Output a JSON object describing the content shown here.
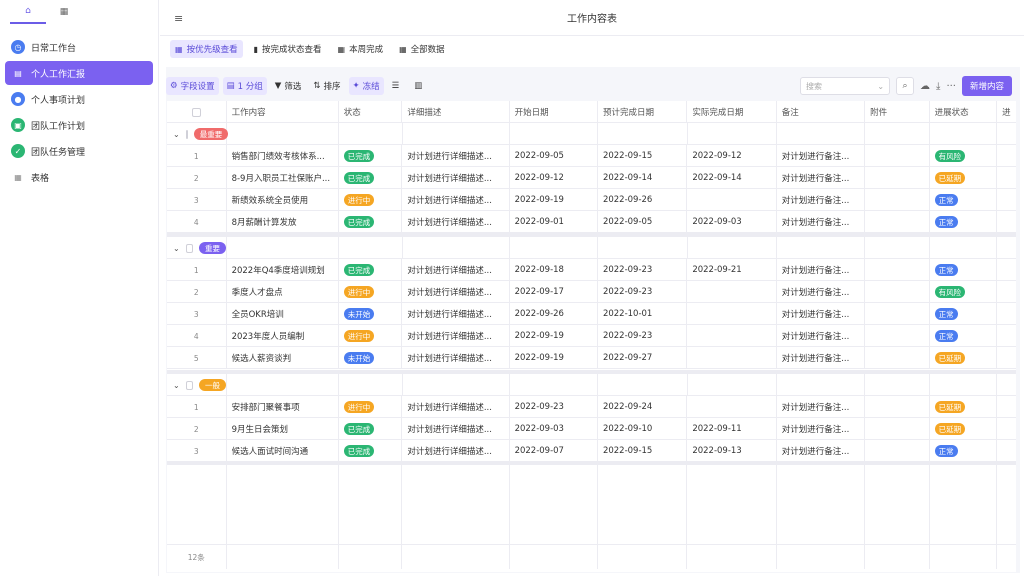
{
  "sidebar": {
    "tabs": [
      {
        "icon": "home-icon",
        "glyph": "⌂"
      },
      {
        "icon": "grid-icon",
        "glyph": "▦"
      }
    ],
    "items": [
      {
        "label": "日常工作台",
        "icon": "clock-icon",
        "glyph": "◷",
        "color": "#4a7cf0",
        "active": false
      },
      {
        "label": "个人工作汇报",
        "icon": "calendar-icon",
        "glyph": "▤",
        "color": "#ffffff",
        "active": true
      },
      {
        "label": "个人事项计划",
        "icon": "person-icon",
        "glyph": "●",
        "color": "#4a7cf0",
        "active": false
      },
      {
        "label": "团队工作计划",
        "icon": "clipboard-icon",
        "glyph": "▣",
        "color": "#2bb673",
        "active": false
      },
      {
        "label": "团队任务管理",
        "icon": "thumbs-up-icon",
        "glyph": "✓",
        "color": "#2bb673",
        "active": false
      },
      {
        "label": "表格",
        "icon": "table-icon",
        "glyph": "▦",
        "color": "#888888",
        "active": false
      }
    ]
  },
  "header": {
    "menu_icon": "≡",
    "title": "工作内容表"
  },
  "views": [
    {
      "label": "按优先级查看",
      "glyph": "▦",
      "active": true
    },
    {
      "label": "按完成状态查看",
      "glyph": "▮",
      "active": false
    },
    {
      "label": "本周完成",
      "glyph": "▦",
      "active": false
    },
    {
      "label": "全部数据",
      "glyph": "▦",
      "active": false
    }
  ],
  "toolbar": {
    "buttons": [
      {
        "label": "字段设置",
        "glyph": "⚙",
        "highlight": true
      },
      {
        "label": "1 分组",
        "glyph": "▤",
        "highlight": true
      },
      {
        "label": "筛选",
        "glyph": "▼",
        "highlight": false
      },
      {
        "label": "排序",
        "glyph": "⇅",
        "highlight": false
      },
      {
        "label": "冻结",
        "glyph": "✦",
        "highlight": true
      },
      {
        "label": "",
        "glyph": "☰",
        "highlight": false
      },
      {
        "label": "",
        "glyph": "▥",
        "highlight": false
      }
    ],
    "search_placeholder": "搜索",
    "search_chevron": "⌄",
    "search_icon": "⌕",
    "upload_icon": "☁",
    "download_icon": "⤓",
    "more_icon": "···",
    "add_label": "新增内容"
  },
  "table": {
    "columns": [
      "",
      "工作内容",
      "状态",
      "详细描述",
      "开始日期",
      "预计完成日期",
      "实际完成日期",
      "备注",
      "附件",
      "进展状态",
      "进"
    ],
    "status_colors": {
      "已完成": "#2bb673",
      "进行中": "#f5a623",
      "未开始": "#4a7cf0"
    },
    "progress_colors": {
      "有风险": "#2bb673",
      "已延期": "#f5a623",
      "正常": "#4a7cf0"
    },
    "groups": [
      {
        "name": "最重要",
        "color": "#f06b6b",
        "rows": [
          {
            "n": "1",
            "task": "销售部门绩效考核体系...",
            "status": "已完成",
            "desc": "对计划进行详细描述...",
            "start": "2022-09-05",
            "plan": "2022-09-15",
            "actual": "2022-09-12",
            "note": "对计划进行备注...",
            "progress": "有风险"
          },
          {
            "n": "2",
            "task": "8-9月入职员工社保账户...",
            "status": "已完成",
            "desc": "对计划进行详细描述...",
            "start": "2022-09-12",
            "plan": "2022-09-14",
            "actual": "2022-09-14",
            "note": "对计划进行备注...",
            "progress": "已延期"
          },
          {
            "n": "3",
            "task": "新绩效系统全员使用",
            "status": "进行中",
            "desc": "对计划进行详细描述...",
            "start": "2022-09-19",
            "plan": "2022-09-26",
            "actual": "",
            "note": "对计划进行备注...",
            "progress": "正常"
          },
          {
            "n": "4",
            "task": "8月薪酬计算发放",
            "status": "已完成",
            "desc": "对计划进行详细描述...",
            "start": "2022-09-01",
            "plan": "2022-09-05",
            "actual": "2022-09-03",
            "note": "对计划进行备注...",
            "progress": "正常"
          }
        ]
      },
      {
        "name": "重要",
        "color": "#7b61f0",
        "rows": [
          {
            "n": "1",
            "task": "2022年Q4季度培训规划",
            "status": "已完成",
            "desc": "对计划进行详细描述...",
            "start": "2022-09-18",
            "plan": "2022-09-23",
            "actual": "2022-09-21",
            "note": "对计划进行备注...",
            "progress": "正常"
          },
          {
            "n": "2",
            "task": "季度人才盘点",
            "status": "进行中",
            "desc": "对计划进行详细描述...",
            "start": "2022-09-17",
            "plan": "2022-09-23",
            "actual": "",
            "note": "对计划进行备注...",
            "progress": "有风险"
          },
          {
            "n": "3",
            "task": "全员OKR培训",
            "status": "未开始",
            "desc": "对计划进行详细描述...",
            "start": "2022-09-26",
            "plan": "2022-10-01",
            "actual": "",
            "note": "对计划进行备注...",
            "progress": "正常"
          },
          {
            "n": "4",
            "task": "2023年度人员编制",
            "status": "进行中",
            "desc": "对计划进行详细描述...",
            "start": "2022-09-19",
            "plan": "2022-09-23",
            "actual": "",
            "note": "对计划进行备注...",
            "progress": "正常"
          },
          {
            "n": "5",
            "task": "候选人薪资谈判",
            "status": "未开始",
            "desc": "对计划进行详细描述...",
            "start": "2022-09-19",
            "plan": "2022-09-27",
            "actual": "",
            "note": "对计划进行备注...",
            "progress": "已延期"
          }
        ]
      },
      {
        "name": "一般",
        "color": "#f5a623",
        "rows": [
          {
            "n": "1",
            "task": "安排部门聚餐事项",
            "status": "进行中",
            "desc": "对计划进行详细描述...",
            "start": "2022-09-23",
            "plan": "2022-09-24",
            "actual": "",
            "note": "对计划进行备注...",
            "progress": "已延期"
          },
          {
            "n": "2",
            "task": "9月生日会策划",
            "status": "已完成",
            "desc": "对计划进行详细描述...",
            "start": "2022-09-03",
            "plan": "2022-09-10",
            "actual": "2022-09-11",
            "note": "对计划进行备注...",
            "progress": "已延期"
          },
          {
            "n": "3",
            "task": "候选人面试时间沟通",
            "status": "已完成",
            "desc": "对计划进行详细描述...",
            "start": "2022-09-07",
            "plan": "2022-09-15",
            "actual": "2022-09-13",
            "note": "对计划进行备注...",
            "progress": "正常"
          }
        ]
      }
    ],
    "footer_count": "12条"
  }
}
